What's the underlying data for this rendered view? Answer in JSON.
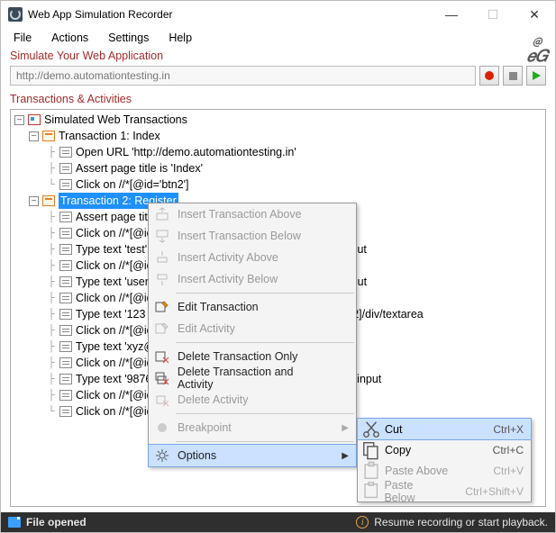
{
  "titlebar": {
    "title": "Web App Simulation Recorder"
  },
  "menubar": [
    "File",
    "Actions",
    "Settings",
    "Help"
  ],
  "logo": {
    "top": "＠",
    "bottom": "𝑒𝐺"
  },
  "simulate_label": "Simulate Your Web Application",
  "url_value": "http://demo.automationtesting.in",
  "transactions_label": "Transactions & Activities",
  "tree": {
    "root": "Simulated Web Transactions",
    "t1": {
      "label": "Transaction 1: Index",
      "acts": [
        "Open URL 'http://demo.automationtesting.in'",
        "Assert page title is 'Index'",
        "Click on //*[@id='btn2']"
      ]
    },
    "t2": {
      "label": "Transaction 2: Register",
      "acts": [
        "Assert page title is",
        "Click on //*[@id=",
        "Type text 'test' in",
        "Click on //*[@id=",
        "Type text 'user' in",
        "Click on //*[@id=",
        "Type text '123 , ab",
        "Click on //*[@id=",
        "Type text 'xyz@12",
        "Click on //*[@id=",
        "Type text '9876543",
        "Click on //*[@id=",
        "Click on //*[@id="
      ],
      "tails": {
        "2": "/input",
        "4": "/input",
        "6": "div[2]/div/textarea",
        "10": "/div/input"
      }
    }
  },
  "context_menu": {
    "items": [
      {
        "label": "Insert Transaction Above",
        "enabled": false
      },
      {
        "label": "Insert Transaction Below",
        "enabled": false
      },
      {
        "label": "Insert Activity Above",
        "enabled": false
      },
      {
        "label": "Insert Activity Below",
        "enabled": false
      },
      {
        "sep": true
      },
      {
        "label": "Edit Transaction",
        "enabled": true
      },
      {
        "label": "Edit Activity",
        "enabled": false
      },
      {
        "sep": true
      },
      {
        "label": "Delete Transaction Only",
        "enabled": true
      },
      {
        "label": "Delete Transaction and Activity",
        "enabled": true
      },
      {
        "label": "Delete Activity",
        "enabled": false
      },
      {
        "sep": true
      },
      {
        "label": "Breakpoint",
        "enabled": false,
        "submenu": true
      },
      {
        "sep": true
      },
      {
        "label": "Options",
        "enabled": true,
        "submenu": true,
        "hover": true
      }
    ],
    "options_submenu": [
      {
        "label": "Cut",
        "shortcut": "Ctrl+X",
        "enabled": true,
        "hover": true
      },
      {
        "label": "Copy",
        "shortcut": "Ctrl+C",
        "enabled": true
      },
      {
        "label": "Paste Above",
        "shortcut": "Ctrl+V",
        "enabled": false
      },
      {
        "label": "Paste Below",
        "shortcut": "Ctrl+Shift+V",
        "enabled": false
      }
    ]
  },
  "statusbar": {
    "left": "File opened",
    "right": "Resume recording or start playback."
  }
}
